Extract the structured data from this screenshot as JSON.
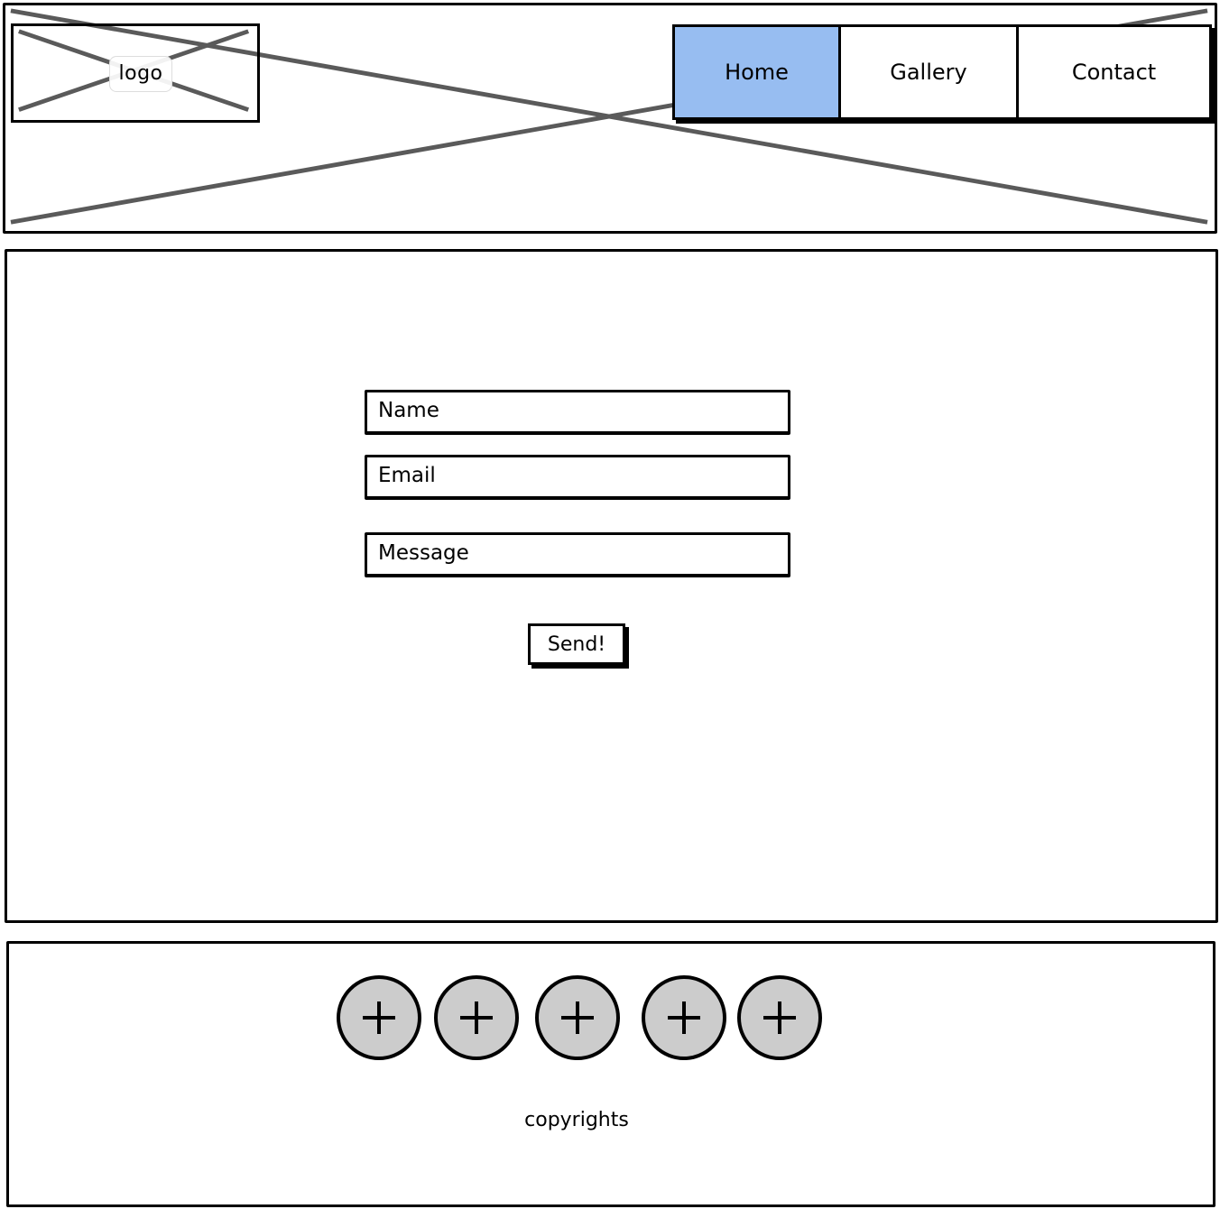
{
  "header": {
    "logo_label": "logo",
    "nav": {
      "items": [
        {
          "label": "Home",
          "active": true
        },
        {
          "label": "Gallery",
          "active": false
        },
        {
          "label": "Contact",
          "active": false
        }
      ],
      "active_color": "#97bdf1"
    }
  },
  "main": {
    "form": {
      "name_placeholder": "Name",
      "email_placeholder": "Email",
      "message_placeholder": "Message",
      "send_label": "Send!"
    }
  },
  "footer": {
    "social_icons": [
      "plus-icon",
      "plus-icon",
      "plus-icon",
      "plus-icon",
      "plus-icon"
    ],
    "icon_fill": "#cccccc",
    "copyright": "copyrights"
  },
  "colors": {
    "placeholder_cross": "#5a5a5a",
    "stroke": "#000000"
  }
}
